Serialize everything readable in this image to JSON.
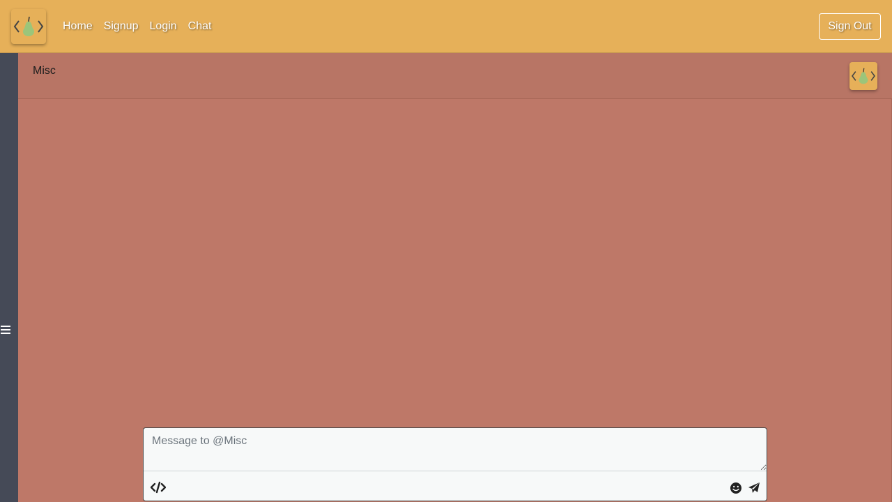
{
  "navbar": {
    "brand_icon": "pear-code-logo-icon",
    "links": [
      {
        "label": "Home"
      },
      {
        "label": "Signup"
      },
      {
        "label": "Login"
      },
      {
        "label": "Chat"
      }
    ],
    "signout_label": "Sign Out"
  },
  "sidebar": {
    "toggle_icon": "hamburger-icon"
  },
  "channel": {
    "title": "Misc",
    "logo_icon": "pear-code-logo-icon"
  },
  "composer": {
    "placeholder": "Message to @Misc",
    "value": "",
    "code_icon": "code-icon",
    "emoji_icon": "smile-icon",
    "send_icon": "paper-plane-icon"
  },
  "colors": {
    "navbar": "#e6b059",
    "sidebar": "#454a57",
    "channel_header": "#b87565",
    "chat_background": "#be7868",
    "composer": "#f7f9f9"
  }
}
